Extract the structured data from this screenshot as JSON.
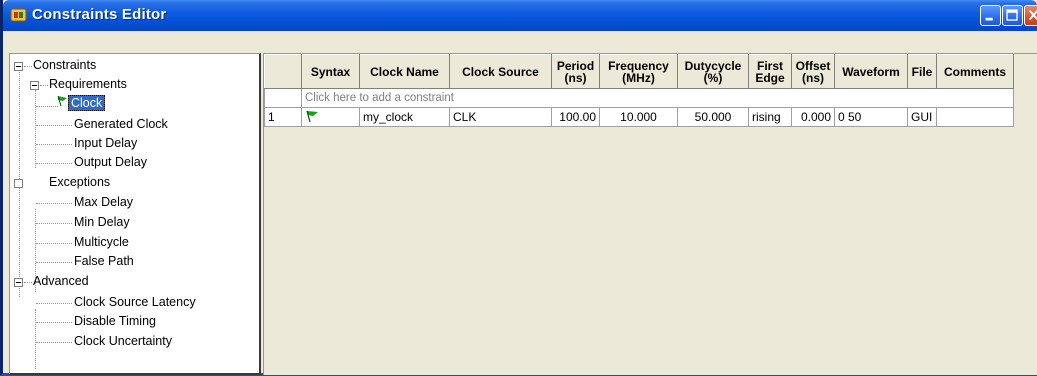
{
  "window": {
    "title": "Constraints Editor",
    "colors": {
      "titlebar": "#0550d8",
      "selection": "#316ac5",
      "close": "#d8542b"
    }
  },
  "title_buttons": {
    "minimize_icon": "minimize-icon",
    "maximize_icon": "maximize-icon",
    "close_icon": "close-icon"
  },
  "tree": {
    "root": "Constraints",
    "requirements": {
      "label": "Requirements",
      "items": [
        "Clock",
        "Generated Clock",
        "Input Delay",
        "Output Delay"
      ]
    },
    "exceptions": {
      "label": "Exceptions",
      "items": [
        "Max Delay",
        "Min Delay",
        "Multicycle",
        "False Path"
      ]
    },
    "advanced": {
      "label": "Advanced",
      "items": [
        "Clock Source Latency",
        "Disable Timing",
        "Clock Uncertainty"
      ]
    }
  },
  "grid": {
    "headers": {
      "syntax": "Syntax",
      "clock_name": "Clock Name",
      "clock_source": "Clock Source",
      "period_1": "Period",
      "period_2": "(ns)",
      "frequency_1": "Frequency",
      "frequency_2": "(MHz)",
      "dutycycle_1": "Dutycycle",
      "dutycycle_2": "(%)",
      "first_edge_1": "First",
      "first_edge_2": "Edge",
      "offset_1": "Offset",
      "offset_2": "(ns)",
      "waveform": "Waveform",
      "file": "File",
      "comments": "Comments"
    },
    "add_row_text": "Click here to add a constraint",
    "rows": [
      {
        "index": "1",
        "syntax_icon": "green-flag-icon",
        "clock_name": "my_clock",
        "clock_source": "CLK",
        "period": "100.00",
        "frequency": "10.000",
        "dutycycle": "50.000",
        "first_edge": "rising",
        "offset": "0.000",
        "waveform": "0 50",
        "file": "GUI",
        "comments": ""
      }
    ]
  }
}
